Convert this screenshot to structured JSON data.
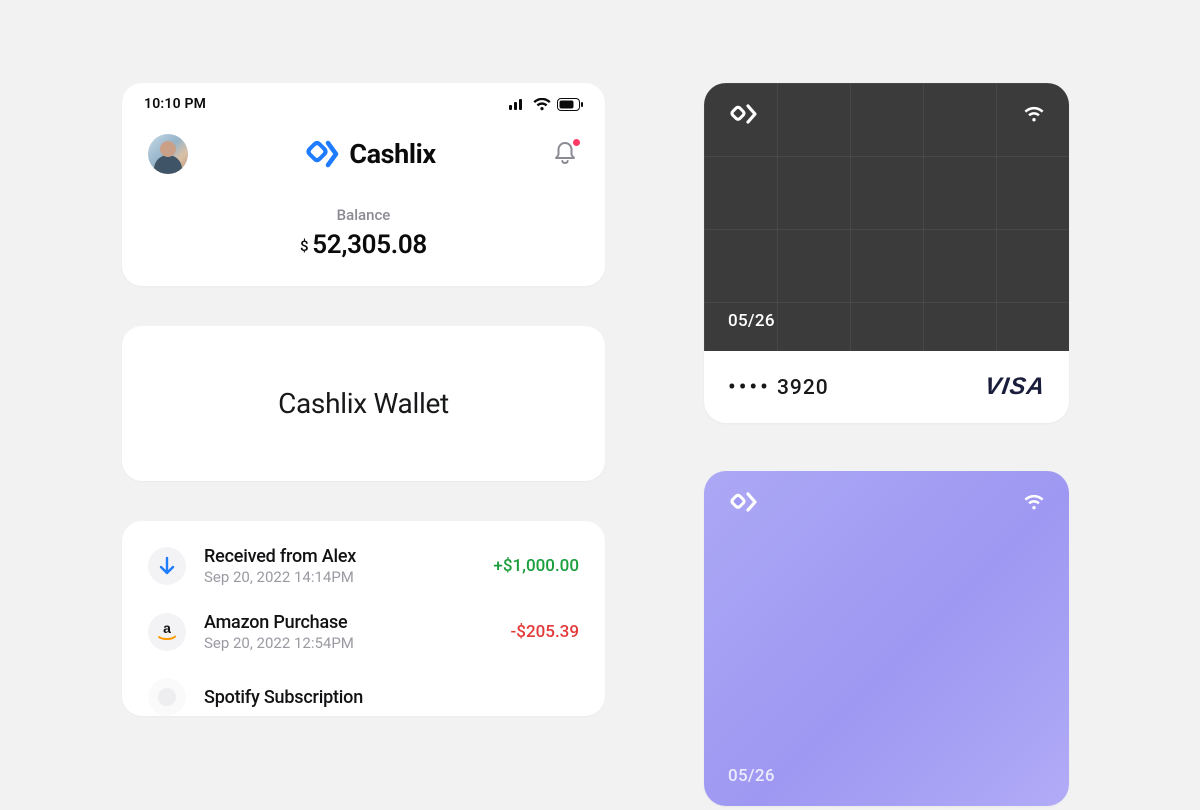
{
  "statusbar": {
    "time": "10:10 PM"
  },
  "header": {
    "brand": "Cashlix",
    "balance_label": "Balance",
    "currency_symbol": "$",
    "balance_value": "52,305.08"
  },
  "wallet": {
    "title": "Cashlix Wallet"
  },
  "transactions": [
    {
      "icon": "arrow-down",
      "title": "Received from Alex",
      "date": "Sep 20, 2022 14:14PM",
      "amount": "+$1,000.00",
      "polarity": "pos"
    },
    {
      "icon": "amazon",
      "title": "Amazon Purchase",
      "date": "Sep 20, 2022 12:54PM",
      "amount": "-$205.39",
      "polarity": "neg"
    },
    {
      "icon": "spotify",
      "title": "Spotify Subscription",
      "date": "",
      "amount": "",
      "polarity": "neg"
    }
  ],
  "cards": [
    {
      "theme": "dark",
      "expiry": "05/26",
      "last4": "3920",
      "network": "VISA"
    },
    {
      "theme": "purple",
      "expiry": "05/26",
      "last4": "",
      "network": ""
    }
  ]
}
